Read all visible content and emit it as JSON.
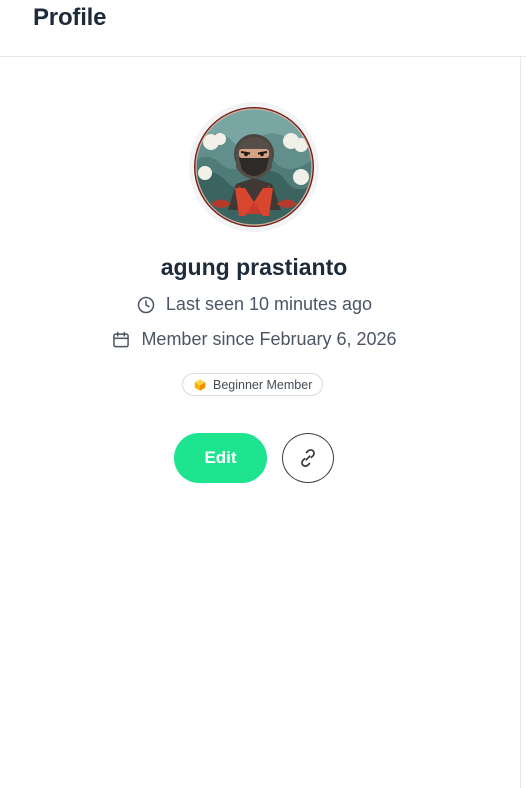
{
  "header": {
    "title": "Profile"
  },
  "profile": {
    "name": "agung prastianto",
    "last_seen": "Last seen 10 minutes ago",
    "member_since": "Member since February 6, 2026",
    "badge": "Beginner Member"
  },
  "actions": {
    "edit_label": "Edit"
  },
  "colors": {
    "accent": "#1ee38f",
    "title": "#1e2b3b",
    "muted": "#4b5563"
  },
  "icons": {
    "last_seen": "clock-icon",
    "member_since": "calendar-icon",
    "badge": "badge-icon",
    "link": "link-icon"
  }
}
